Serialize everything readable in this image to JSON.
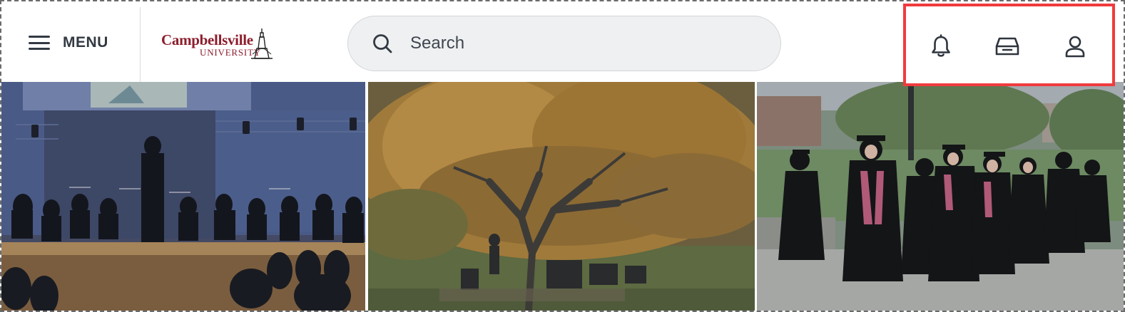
{
  "header": {
    "menu_label": "MENU",
    "logo": {
      "line1": "Campbellsville",
      "line2": "UNIVERSITY"
    },
    "search": {
      "placeholder": "Search",
      "value": ""
    },
    "actions": [
      {
        "name": "notifications",
        "icon": "bell-icon"
      },
      {
        "name": "inbox",
        "icon": "inbox-icon"
      },
      {
        "name": "profile",
        "icon": "user-icon"
      }
    ],
    "highlight_color": "#f03b3e"
  },
  "colors": {
    "logo": "#8c1d2c",
    "text": "#333a44",
    "search_bg": "#eff0f1"
  },
  "photos": [
    {
      "name": "photo-band",
      "subject": "orchestra-on-stage"
    },
    {
      "name": "photo-tree",
      "subject": "autumn-tree-on-campus"
    },
    {
      "name": "photo-graduation",
      "subject": "graduates-walking"
    }
  ]
}
